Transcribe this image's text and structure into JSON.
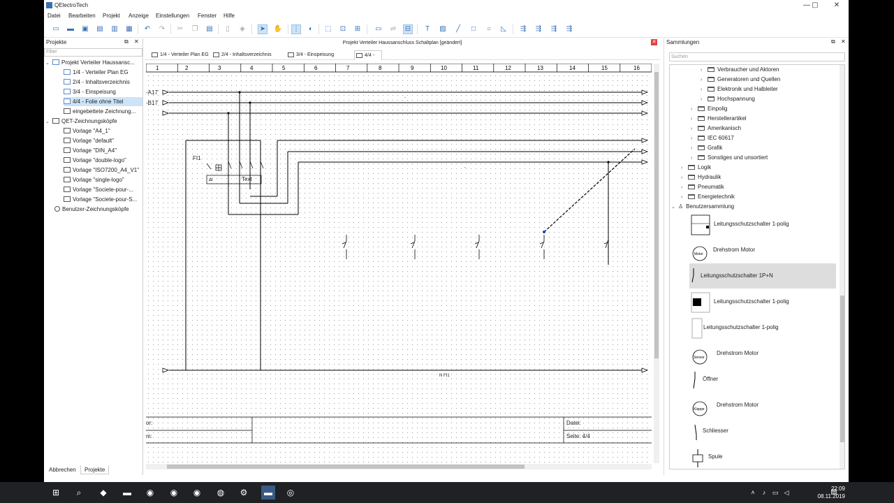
{
  "window": {
    "title": "QElectroTech",
    "minimize": "—",
    "maximize": "▢",
    "close": "✕"
  },
  "menu": [
    "Datei",
    "Bearbeiten",
    "Projekt",
    "Anzeige",
    "Einstellungen",
    "Fenster",
    "Hilfe"
  ],
  "projects_panel": {
    "title": "Projekte",
    "filter_placeholder": "Filter",
    "items": [
      {
        "label": "Projekt Verteiler Haussansc..."
      },
      {
        "label": "1/4 - Verteiler Plan EG"
      },
      {
        "label": "2/4 - Inhaltsverzeichnis"
      },
      {
        "label": "3/4 - Einspeisung"
      },
      {
        "label": "4/4 - Folie ohne Titel"
      },
      {
        "label": "eingebettete Zeichnung..."
      },
      {
        "label": "QET-Zeichnungsköpfe"
      },
      {
        "label": "Vorlage \"A4_1\""
      },
      {
        "label": "Vorlage \"default\""
      },
      {
        "label": "Vorlage \"DIN_A4\""
      },
      {
        "label": "Vorlage \"double-logo\""
      },
      {
        "label": "Vorlage \"ISO7200_A4_V1\""
      },
      {
        "label": "Vorlage \"single-logo\""
      },
      {
        "label": "Vorlage \"Societe-pour-..."
      },
      {
        "label": "Vorlage \"Societe-pour-S..."
      },
      {
        "label": "Benutzer-Zeichnungsköpfe"
      }
    ],
    "bottom_tabs": [
      "Abbrechen",
      "Projekte"
    ]
  },
  "document": {
    "title": "Projekt Verteiler Haussanschluss Schaltplan [geändert]",
    "tabs": [
      "1/4 - Verteiler Plan EG",
      "2/4 - Inhaltsverzeichnis",
      "3/4 - Einspeisung",
      "4/4 -"
    ],
    "columns": [
      "1",
      "2",
      "3",
      "4",
      "5",
      "6",
      "7",
      "8",
      "9",
      "10",
      "11",
      "12",
      "13",
      "14",
      "15",
      "16"
    ],
    "labels": {
      "a17": "-A17",
      "b17": "-B17",
      "fi": "FI1",
      "text": "Text",
      "npe": "N FI1",
      "dot1": "-",
      "dot2": "-"
    },
    "titleblock": {
      "autor": "or:",
      "datum": "m:",
      "datei": "Datei:",
      "seite": "Seite: 4/4"
    }
  },
  "collections": {
    "title": "Sammlungen",
    "search_placeholder": "Suchen",
    "tree": [
      {
        "label": "Verbraucher und Aktoren",
        "level": 3
      },
      {
        "label": "Generatoren und Quellen",
        "level": 3
      },
      {
        "label": "Elektronik und Halbleiter",
        "level": 3
      },
      {
        "label": "Hochspannung",
        "level": 3
      },
      {
        "label": "Einpolig",
        "level": 2
      },
      {
        "label": "Herstellerartikel",
        "level": 2
      },
      {
        "label": "Amerikanisch",
        "level": 2
      },
      {
        "label": "IEC 60617",
        "level": 2
      },
      {
        "label": "Grafik",
        "level": 2
      },
      {
        "label": "Sonstiges und unsortiert",
        "level": 2
      },
      {
        "label": "Logik",
        "level": 1
      },
      {
        "label": "Hydraulik",
        "level": 1
      },
      {
        "label": "Pneumatik",
        "level": 1
      },
      {
        "label": "Energietechnik",
        "level": 1
      },
      {
        "label": "Benutzersammlung",
        "level": 0
      }
    ],
    "elements": [
      {
        "label": "Leitungsschutzschalter 1-polig"
      },
      {
        "label": "Drehstrom Motor",
        "badge": "Motor"
      },
      {
        "label": "Leitungsschutzschalter 1P+N"
      },
      {
        "label": "Leitungsschutzschalter 1-polig"
      },
      {
        "label": "Leitungsschutzschalter 1-polig"
      },
      {
        "label": "Drehstrom Motor",
        "badge": "Sensor"
      },
      {
        "label": "Öffner"
      },
      {
        "label": "Drehstrom Motor",
        "badge": "Klappe"
      },
      {
        "label": "Schliesser"
      },
      {
        "label": "Spule"
      }
    ]
  },
  "taskbar": {
    "time": "22:09",
    "date": "08.11.2019"
  }
}
